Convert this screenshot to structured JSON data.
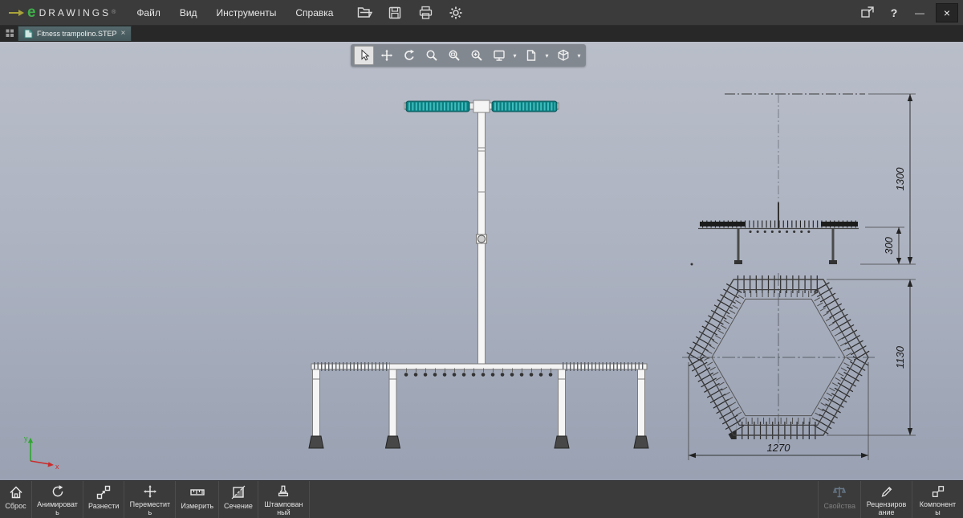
{
  "app": {
    "logo": {
      "e": "e",
      "text": "DRAWINGS",
      "reg": "®"
    },
    "menus": [
      {
        "label": "Файл"
      },
      {
        "label": "Вид"
      },
      {
        "label": "Инструменты"
      },
      {
        "label": "Справка"
      }
    ]
  },
  "window_controls": {
    "help": "?",
    "minimize": "—",
    "close": "×"
  },
  "tab_bar": {
    "tab": {
      "title": "Fitness trampolino.STEP",
      "close": "×"
    }
  },
  "floating_toolbar": {
    "caret": "▾"
  },
  "drawing": {
    "dim_height_total": "1300",
    "dim_height_base": "300",
    "dim_width_side": "1130",
    "dim_width_bottom": "1270"
  },
  "triad": {
    "x": "x",
    "y": "y"
  },
  "bottom_toolbar": {
    "buttons": [
      {
        "label": "Сброс"
      },
      {
        "label": "Анимировать"
      },
      {
        "label": "Разнести"
      },
      {
        "label": "Переместить"
      },
      {
        "label": "Измерить"
      },
      {
        "label": "Сечение"
      },
      {
        "label": "Штампованный"
      }
    ],
    "right_buttons": [
      {
        "label": "Свойства"
      },
      {
        "label": "Рецензирование"
      },
      {
        "label": "Компоненты"
      }
    ]
  }
}
